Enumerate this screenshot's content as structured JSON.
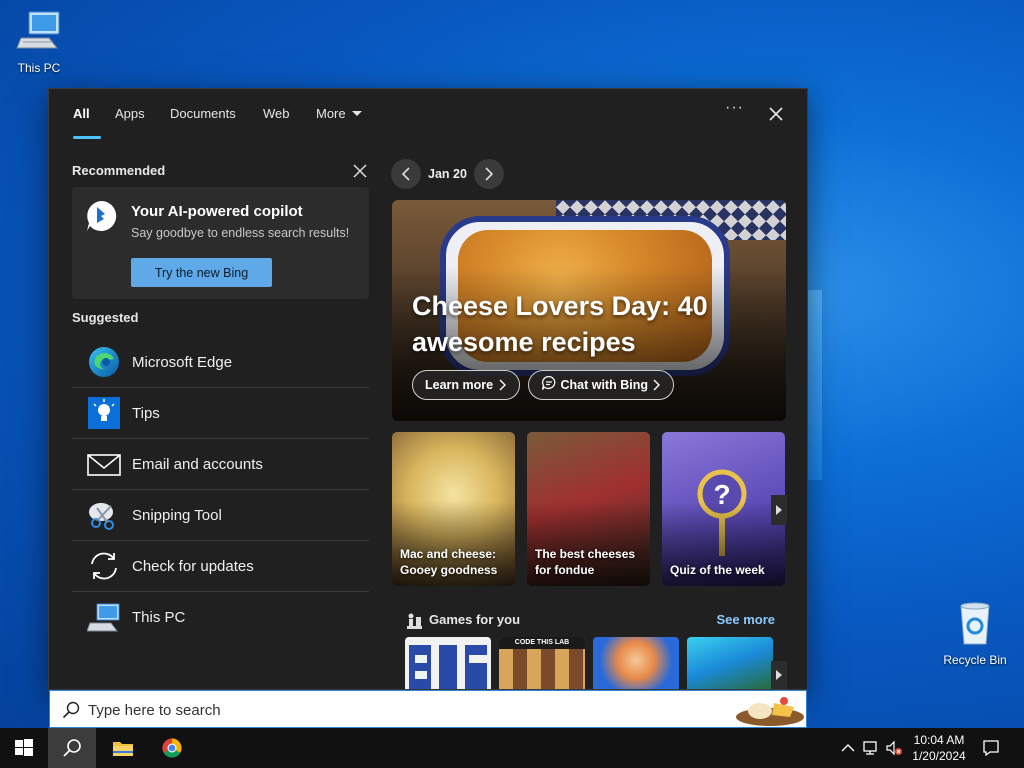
{
  "desktop": {
    "this_pc_label": "This PC",
    "recycle_bin_label": "Recycle Bin"
  },
  "tabs": [
    {
      "label": "All",
      "active": true
    },
    {
      "label": "Apps"
    },
    {
      "label": "Documents"
    },
    {
      "label": "Web"
    },
    {
      "label": "More"
    }
  ],
  "panel": {
    "more_options": "···"
  },
  "recommended": {
    "heading": "Recommended",
    "title": "Your AI-powered copilot",
    "subtitle": "Say goodbye to endless search results!",
    "button_label": "Try the new Bing"
  },
  "suggested": {
    "heading": "Suggested",
    "items": [
      {
        "label": "Microsoft Edge",
        "icon": "edge-icon"
      },
      {
        "label": "Tips",
        "icon": "tips-icon"
      },
      {
        "label": "Email and accounts",
        "icon": "mail-icon"
      },
      {
        "label": "Snipping Tool",
        "icon": "snipping-tool-icon"
      },
      {
        "label": "Check for updates",
        "icon": "refresh-icon"
      },
      {
        "label": "This PC",
        "icon": "computer-icon"
      }
    ]
  },
  "highlights": {
    "date": "Jan 20",
    "hero_title": "Cheese Lovers Day: 40 awesome recipes",
    "learn_more": "Learn more",
    "chat_with_bing": "Chat with Bing",
    "cards": [
      {
        "caption": "Mac and cheese: Gooey goodness"
      },
      {
        "caption": "The best cheeses for fondue"
      },
      {
        "caption": "Quiz of the week"
      }
    ],
    "games_heading": "Games for you",
    "see_more": "See more",
    "game_tile_text": "CODE THIS LAB"
  },
  "search": {
    "placeholder": "Type here to search"
  },
  "taskbar": {
    "time": "10:04 AM",
    "date": "1/20/2024"
  },
  "colors": {
    "accent": "#4cc2ff",
    "button_blue": "#60a9e8",
    "panel_bg": "#202020",
    "taskbar_bg": "#111111"
  }
}
